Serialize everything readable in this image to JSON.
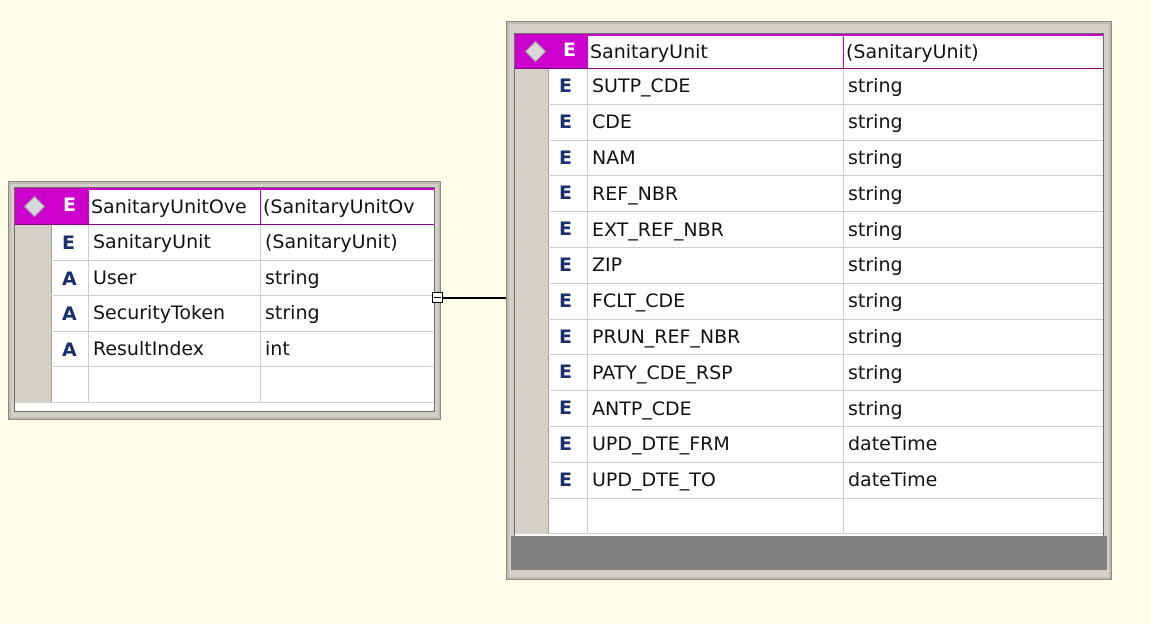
{
  "left_table": {
    "header": {
      "kind": "E",
      "name": "SanitaryUnitOve",
      "type": "(SanitaryUnitOv"
    },
    "rows": [
      {
        "kind": "E",
        "name": "SanitaryUnit",
        "type": "(SanitaryUnit)"
      },
      {
        "kind": "A",
        "name": "User",
        "type": "string"
      },
      {
        "kind": "A",
        "name": "SecurityToken",
        "type": "string"
      },
      {
        "kind": "A",
        "name": "ResultIndex",
        "type": "int"
      },
      {
        "kind": "",
        "name": "",
        "type": ""
      }
    ]
  },
  "right_table": {
    "header": {
      "kind": "E",
      "name": "SanitaryUnit",
      "type": "(SanitaryUnit)"
    },
    "rows": [
      {
        "kind": "E",
        "name": "SUTP_CDE",
        "type": "string"
      },
      {
        "kind": "E",
        "name": "CDE",
        "type": "string"
      },
      {
        "kind": "E",
        "name": "NAM",
        "type": "string"
      },
      {
        "kind": "E",
        "name": "REF_NBR",
        "type": "string"
      },
      {
        "kind": "E",
        "name": "EXT_REF_NBR",
        "type": "string"
      },
      {
        "kind": "E",
        "name": "ZIP",
        "type": "string"
      },
      {
        "kind": "E",
        "name": "FCLT_CDE",
        "type": "string"
      },
      {
        "kind": "E",
        "name": "PRUN_REF_NBR",
        "type": "string"
      },
      {
        "kind": "E",
        "name": "PATY_CDE_RSP",
        "type": "string"
      },
      {
        "kind": "E",
        "name": "ANTP_CDE",
        "type": "string"
      },
      {
        "kind": "E",
        "name": "UPD_DTE_FRM",
        "type": "dateTime"
      },
      {
        "kind": "E",
        "name": "UPD_DTE_TO",
        "type": "dateTime"
      },
      {
        "kind": "",
        "name": "",
        "type": ""
      }
    ]
  },
  "colors": {
    "background": "#fdfde8",
    "header_accent": "#cc00cc",
    "kind_letter": "#1a2f6e",
    "footer": "#808080"
  },
  "icons": {
    "header_marker": "diamond-icon",
    "expand_toggle": "collapse-icon"
  }
}
